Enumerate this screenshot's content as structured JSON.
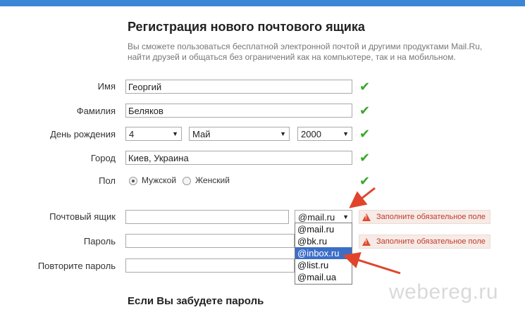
{
  "header": {
    "title": "Регистрация нового почтового ящика",
    "subtitle": "Вы сможете пользоваться бесплатной электронной почтой и другими продуктами Mail.Ru, найти друзей и общаться без ограничений как на компьютере, так и на мобильном."
  },
  "form": {
    "first_name": {
      "label": "Имя",
      "value": "Георгий"
    },
    "last_name": {
      "label": "Фамилия",
      "value": "Беляков"
    },
    "birthday": {
      "label": "День рождения",
      "day": "4",
      "month": "Май",
      "year": "2000"
    },
    "city": {
      "label": "Город",
      "value": "Киев, Украина"
    },
    "gender": {
      "label": "Пол",
      "male": "Мужской",
      "female": "Женский",
      "selected": "male"
    },
    "mailbox": {
      "label": "Почтовый ящик",
      "value": "",
      "domain": "@mail.ru",
      "domain_options": [
        "@mail.ru",
        "@bk.ru",
        "@inbox.ru",
        "@list.ru",
        "@mail.ua"
      ],
      "highlighted_option": "@inbox.ru",
      "error": "Заполните обязательное поле"
    },
    "password": {
      "label": "Пароль",
      "value": "",
      "error": "Заполните обязательное поле"
    },
    "password_repeat": {
      "label": "Повторите пароль",
      "value": ""
    }
  },
  "section": {
    "forgot_password_title": "Если Вы забудете пароль"
  },
  "watermark": "webereg.ru",
  "colors": {
    "accent_bar": "#3b87d6",
    "check": "#3aa82b",
    "error_text": "#c0392b",
    "error_bg": "#f6ebe6",
    "highlight": "#3d6ec7",
    "annotation_arrow": "#e0452c"
  },
  "icons": {
    "valid": "check-icon",
    "error": "warning-icon",
    "select_arrow": "caret-down-icon"
  }
}
